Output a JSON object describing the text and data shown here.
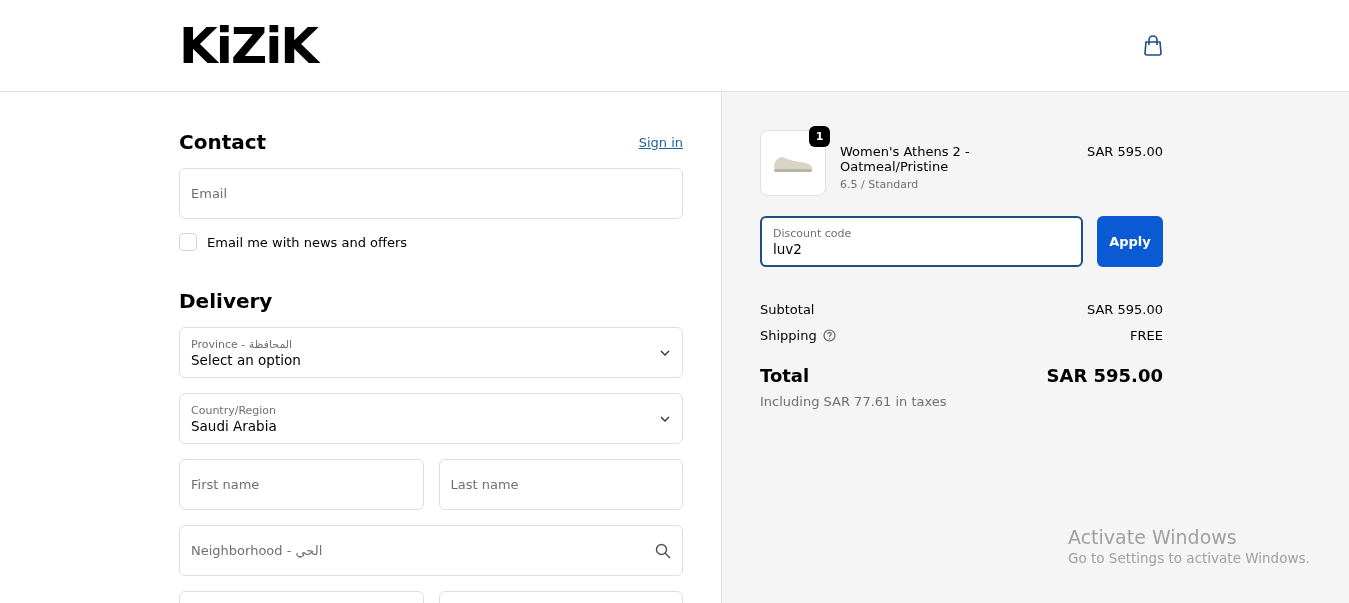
{
  "header": {
    "logo": "KiZiK"
  },
  "contact": {
    "title": "Contact",
    "sign_in": "Sign in",
    "email": {
      "placeholder": "Email"
    },
    "newsletter": {
      "label": "Email me with news and offers",
      "checked": false
    }
  },
  "delivery": {
    "title": "Delivery",
    "fields": [
      {
        "kind": "select",
        "label": "Province - المحافظة",
        "value": "Select an option"
      },
      {
        "kind": "select",
        "label": "Country/Region",
        "value": "Saudi Arabia"
      },
      {
        "kind": "half",
        "placeholder": "First name"
      },
      {
        "kind": "half",
        "placeholder": "Last name"
      },
      {
        "kind": "search",
        "placeholder": "Neighborhood - الحي"
      }
    ]
  },
  "summary": {
    "item": {
      "quantity": "1",
      "name": "Women's Athens 2 - Oatmeal/Pristine",
      "variant": "6.5 / Standard",
      "price": "SAR 595.00"
    },
    "discount": {
      "label": "Discount code",
      "value": "luv2",
      "focused": true,
      "button": "Apply"
    },
    "lines": [
      {
        "kind": "plain",
        "label": "Subtotal",
        "value": "SAR 595.00"
      },
      {
        "kind": "help",
        "label": "Shipping",
        "value": "FREE"
      }
    ],
    "total": {
      "label": "Total",
      "value": "SAR 595.00",
      "note": "Including SAR 77.61 in taxes"
    }
  },
  "os_overlay": {
    "title": "Activate Windows",
    "subtitle": "Go to Settings to activate Windows."
  }
}
